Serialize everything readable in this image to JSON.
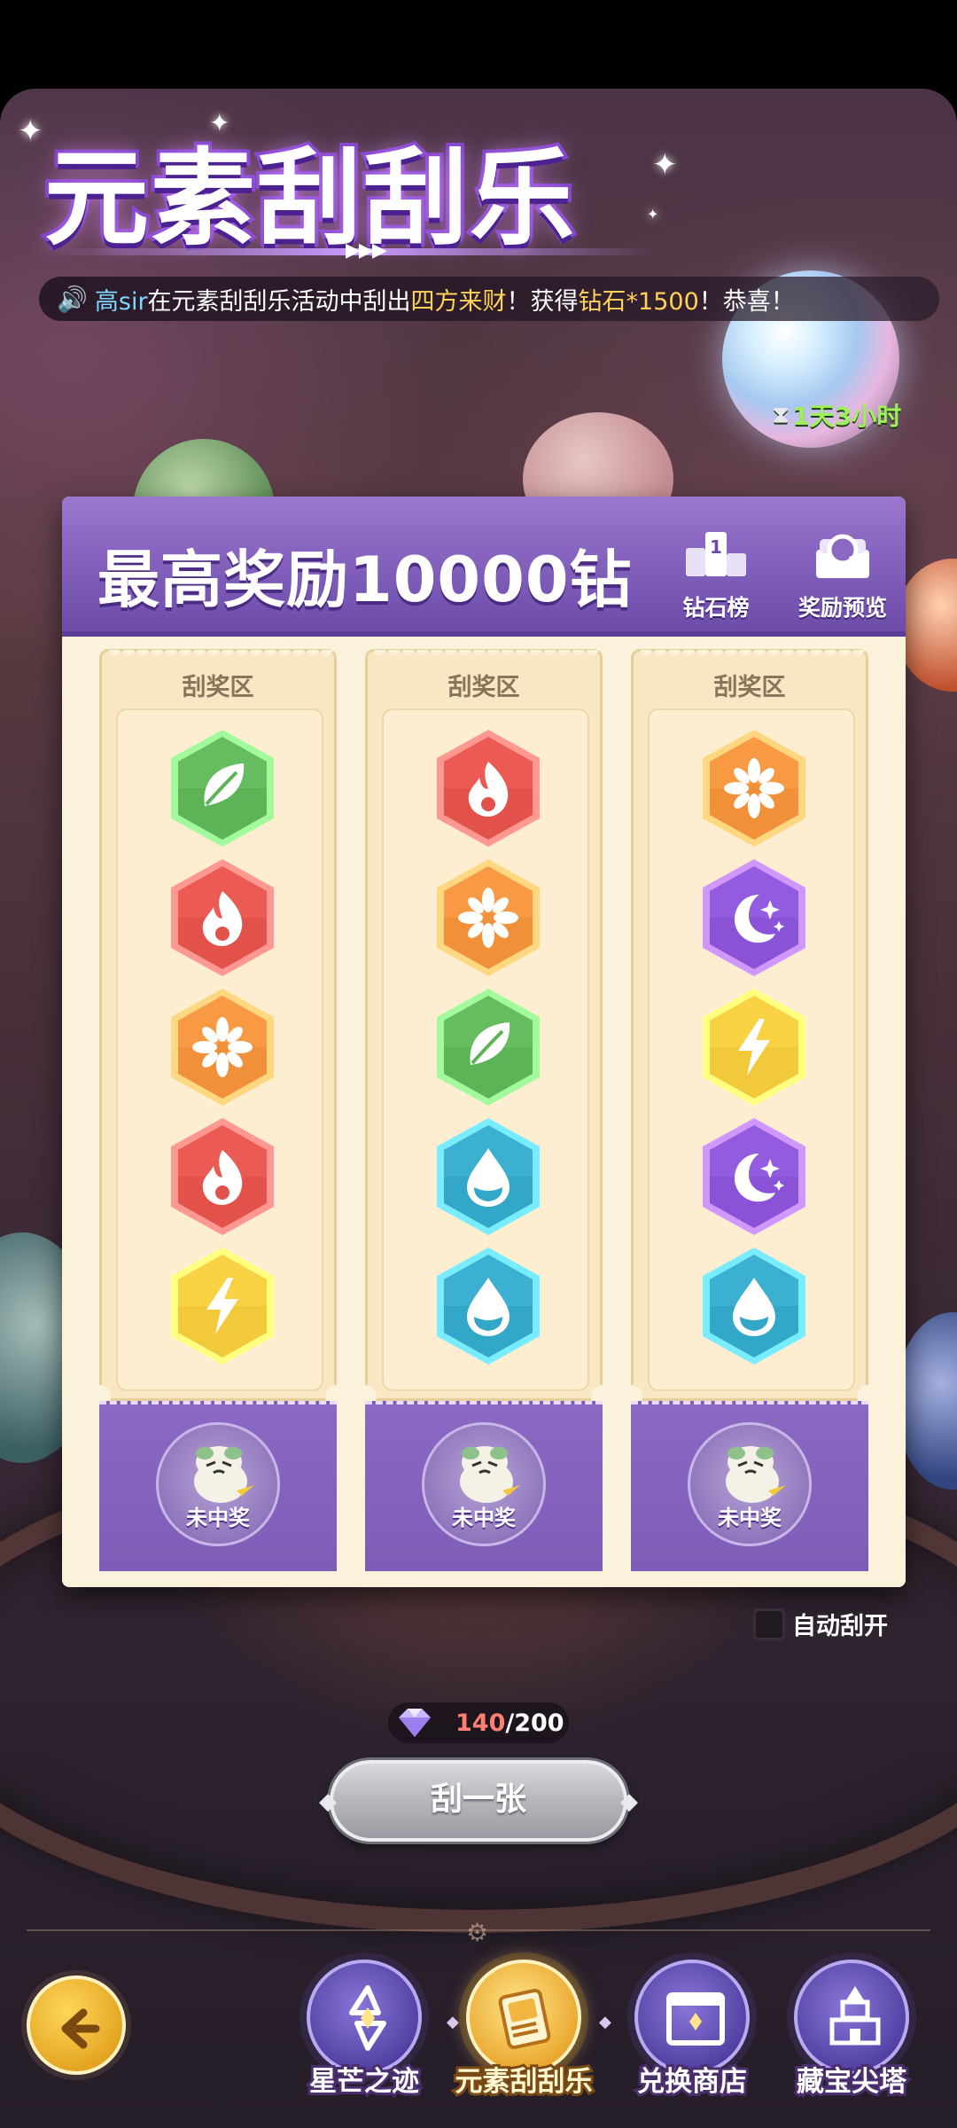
{
  "header": {
    "title": "元素刮刮乐",
    "title_arrows": "▶▶▶"
  },
  "marquee": {
    "name": "高sir",
    "middle": "在元素刮刮乐活动中刮出",
    "combo": "四方来财",
    "mid2": "！获得",
    "prize": "钻石*1500",
    "end": "！恭喜！"
  },
  "timer": {
    "text": "1天3小时"
  },
  "panel": {
    "headline": "最高奖励10000钻",
    "rank_label": "钻石榜",
    "preview_label": "奖励预览"
  },
  "tickets": [
    {
      "zone_label": "刮奖区",
      "elements": [
        "grass",
        "fire",
        "light",
        "fire",
        "thunder"
      ],
      "result": "未中奖"
    },
    {
      "zone_label": "刮奖区",
      "elements": [
        "fire",
        "light",
        "grass",
        "water",
        "water"
      ],
      "result": "未中奖"
    },
    {
      "zone_label": "刮奖区",
      "elements": [
        "light",
        "dark",
        "thunder",
        "dark",
        "water"
      ],
      "result": "未中奖"
    }
  ],
  "element_colors": {
    "grass": "#5cb457",
    "fire": "#e2524a",
    "light": "#f0913a",
    "thunder": "#f2c93a",
    "water": "#33a7c7",
    "dark": "#8a52d6"
  },
  "auto_scratch": {
    "label": "自动刮开",
    "checked": false
  },
  "gems": {
    "current": "140",
    "max": "/200"
  },
  "scratch_button": {
    "label": "刮一张"
  },
  "nav": {
    "items": [
      {
        "label": "星芒之迹",
        "icon": "star-trail-icon"
      },
      {
        "label": "元素刮刮乐",
        "icon": "scratch-card-icon",
        "active": true
      },
      {
        "label": "兑换商店",
        "icon": "shop-icon"
      },
      {
        "label": "藏宝尖塔",
        "icon": "treasure-tower-icon"
      }
    ]
  }
}
